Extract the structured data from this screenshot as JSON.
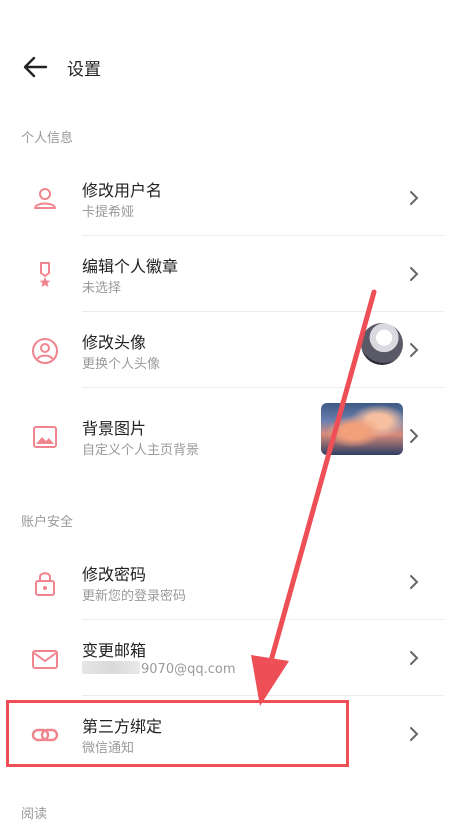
{
  "header": {
    "title": "设置"
  },
  "sections": {
    "personal": "个人信息",
    "account": "账户安全",
    "reading": "阅读"
  },
  "rows": {
    "username": {
      "label": "修改用户名",
      "sub": "卡提希娅"
    },
    "badge": {
      "label": "编辑个人徽章",
      "sub": "未选择"
    },
    "avatar": {
      "label": "修改头像",
      "sub": "更换个人头像"
    },
    "background": {
      "label": "背景图片",
      "sub": "自定义个人主页背景"
    },
    "password": {
      "label": "修改密码",
      "sub": "更新您的登录密码"
    },
    "email": {
      "label": "变更邮箱",
      "sub": "9070@qq.com"
    },
    "thirdparty": {
      "label": "第三方绑定",
      "sub": "微信通知"
    }
  },
  "colors": {
    "accent": "#f0858f",
    "annotation": "#ee4f56"
  },
  "icons": {
    "back": "arrow-left-icon",
    "username": "person-icon",
    "badge": "medal-icon",
    "avatar": "user-circle-icon",
    "background": "image-icon",
    "password": "lock-icon",
    "email": "mail-icon",
    "thirdparty": "link-icon",
    "chevron": "chevron-right-icon"
  }
}
